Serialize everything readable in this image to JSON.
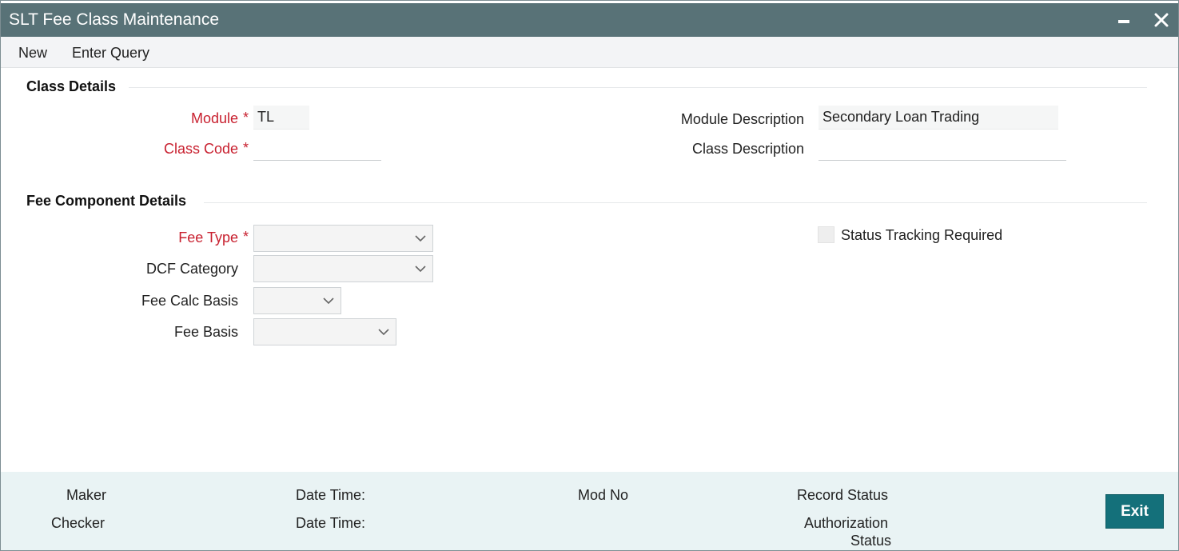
{
  "window": {
    "title": "SLT Fee Class Maintenance"
  },
  "toolbar": {
    "new_label": "New",
    "enter_query_label": "Enter Query"
  },
  "class_details": {
    "section_title": "Class Details",
    "module_label": "Module",
    "module_value": "TL",
    "class_code_label": "Class Code",
    "class_code_value": "",
    "module_description_label": "Module Description",
    "module_description_value": "Secondary Loan Trading",
    "class_description_label": "Class Description",
    "class_description_value": ""
  },
  "fee_component_details": {
    "section_title": "Fee Component Details",
    "fee_type_label": "Fee Type",
    "fee_type_value": "",
    "dcf_category_label": "DCF Category",
    "dcf_category_value": "",
    "fee_calc_basis_label": "Fee Calc Basis",
    "fee_calc_basis_value": "",
    "fee_basis_label": "Fee Basis",
    "fee_basis_value": "",
    "status_tracking_label": "Status Tracking Required",
    "status_tracking_checked": false
  },
  "required_marker": "*",
  "footer": {
    "maker_label": "Maker",
    "checker_label": "Checker",
    "date_time_label_1": "Date Time:",
    "date_time_label_2": "Date Time:",
    "mod_no_label": "Mod No",
    "record_status_label": "Record Status",
    "authorization_label": "Authorization",
    "status_label": "Status",
    "exit_label": "Exit"
  },
  "colors": {
    "titlebar": "#587277",
    "required": "#c8202f",
    "footer_bg": "#e9f3f4",
    "exit_button": "#14707a"
  },
  "icons": {
    "minimize": "minimize-icon",
    "close": "close-icon",
    "dropdown": "chevron-down-icon"
  }
}
